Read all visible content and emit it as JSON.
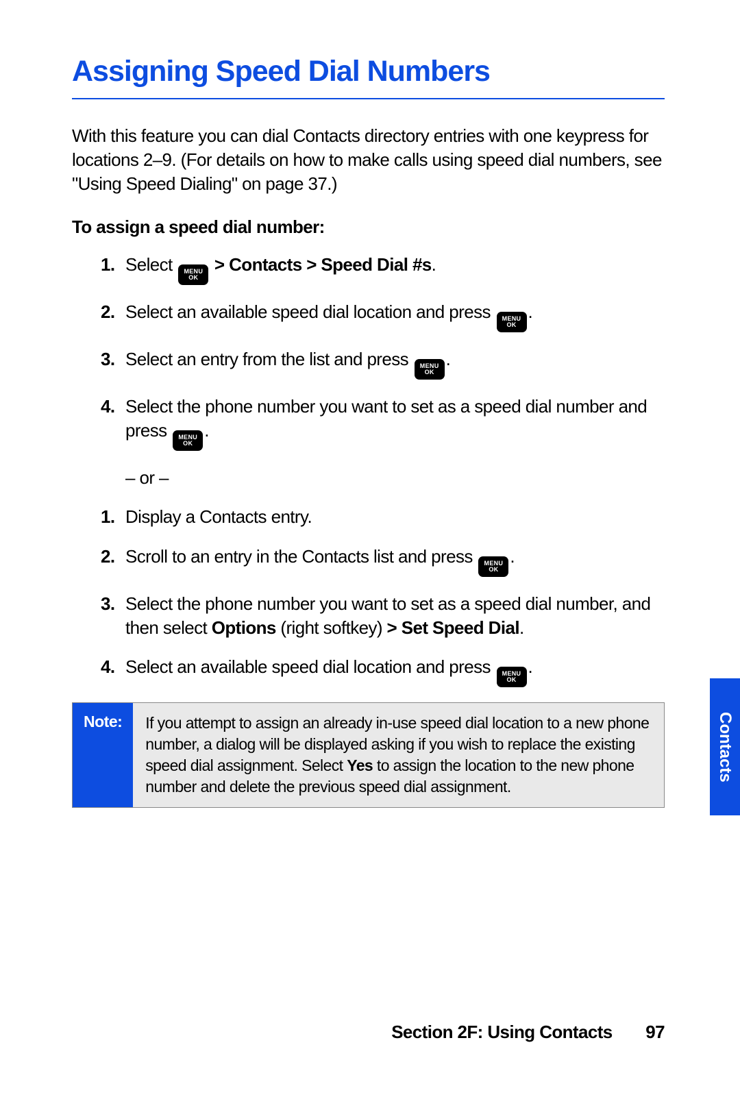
{
  "heading": "Assigning Speed Dial Numbers",
  "intro": "With this feature you can dial Contacts directory entries with one keypress for locations 2–9. (For details on how to make calls using speed dial numbers, see \"Using Speed Dialing\" on page 37.)",
  "subhead": "To assign a speed dial number:",
  "icon": {
    "line1": "MENU",
    "line2": "OK"
  },
  "listA": {
    "1": {
      "num": "1.",
      "a": "Select ",
      "b": " > Contacts > Speed Dial #s",
      "c": "."
    },
    "2": {
      "num": "2.",
      "a": "Select an available speed dial location and press ",
      "c": "."
    },
    "3": {
      "num": "3.",
      "a": "Select an entry from the list and press ",
      "c": "."
    },
    "4": {
      "num": "4.",
      "a": "Select the phone number you want to set as a speed dial number and press ",
      "c": "."
    }
  },
  "or": "– or –",
  "listB": {
    "1": {
      "num": "1.",
      "a": "Display a Contacts entry."
    },
    "2": {
      "num": "2.",
      "a": "Scroll to an entry in the Contacts list and press ",
      "c": "."
    },
    "3": {
      "num": "3.",
      "a": "Select the phone number you want to set as a speed dial number, and then select ",
      "b1": "Options",
      "mid": " (right softkey) ",
      "b2": "> Set Speed Dial",
      "c": "."
    },
    "4": {
      "num": "4.",
      "a": "Select an available speed dial location and press ",
      "c": "."
    }
  },
  "note": {
    "label": "Note:",
    "a": "If you attempt to assign an already in-use speed dial location to a new phone number, a dialog will be displayed asking if you wish to replace the existing speed dial assignment. Select ",
    "b": "Yes",
    "c": " to assign the location to the new phone number and delete the previous speed dial assignment."
  },
  "sideTab": "Contacts",
  "footer": {
    "section": "Section 2F: Using Contacts",
    "page": "97"
  }
}
